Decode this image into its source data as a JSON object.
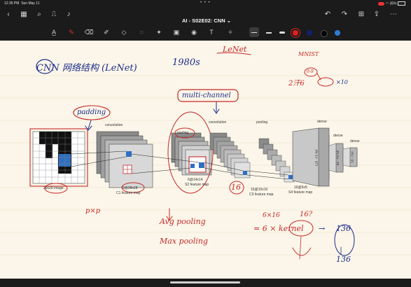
{
  "status": {
    "time": "12:35 PM",
    "date": "Sun May 11",
    "battery": "35%"
  },
  "navbar": {
    "title": "AI - S02E02: CNN",
    "title_chevron": "⌄"
  },
  "notes": {
    "title": "CNN 网络结构 (LeNet)",
    "era": "1980s",
    "lenet": "LeNet",
    "mnist": "MNIST",
    "mnist_count": "2汗6",
    "mnist_digits": "0-9",
    "mnist_x": "×10",
    "padding": "padding",
    "multi_channel": "multi-channel",
    "pxp": "p×p",
    "avg_pooling": "Avg pooling",
    "max_pooling": "Max pooling",
    "n16": "16",
    "n16b": "16?",
    "sixx16": "6×16",
    "formula": "= 6 × kernel",
    "n136": "136",
    "n136b": "136",
    "arrow": "→"
  },
  "diagram": {
    "input_label": "28x28 image",
    "conv1_title": "convolution",
    "c1_size": "6@28x28",
    "c1_label": "C1 feature map",
    "pool1_title": "pooling",
    "s2_size": "6@14x14",
    "s2_label": "S2 feature map",
    "conv2_title": "convolution",
    "c3_size": "16@10x10",
    "c3_label": "C3 feature map",
    "pool2_title": "pooling",
    "s4_size": "16@5x5",
    "s4_label": "S4 feature map",
    "dense1_title": "dense",
    "f5_label": "120 - F5 full",
    "dense2_title": "dense",
    "f6_label": "84 - F6 full",
    "dense3_title": "dense",
    "out_label": "10 - Out"
  }
}
